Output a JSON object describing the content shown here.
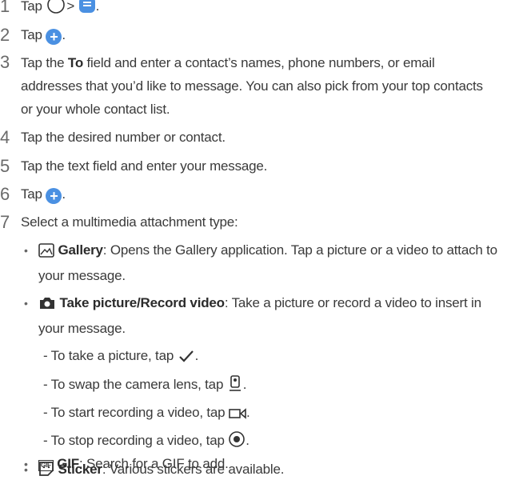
{
  "steps": [
    {
      "n": "1",
      "pre": "Tap",
      "mid": ">",
      "post": "."
    },
    {
      "n": "2",
      "pre": "Tap",
      "post": "."
    },
    {
      "n": "3",
      "a": "Tap the ",
      "b": "To",
      "c": " field and enter a contact’s names, phone numbers, or email addresses that you’d like to message. You can also pick from your top contacts or your whole contact list."
    },
    {
      "n": "4",
      "text": "Tap the desired number or contact."
    },
    {
      "n": "5",
      "text": "Tap the text field and enter your message."
    },
    {
      "n": "6",
      "pre": "Tap",
      "post": "."
    },
    {
      "n": "7",
      "text": "Select a multimedia attachment type:"
    }
  ],
  "bullets": {
    "dot": "•",
    "gallery": {
      "title": "Gallery",
      "text": ": Opens the Gallery application. Tap a picture or a video to attach to your message."
    },
    "take": {
      "title": "Take picture/Record video",
      "text": ": Take a picture or record a video to insert in your message."
    },
    "subs": [
      {
        "text": "- To take a picture, tap",
        "end": "."
      },
      {
        "text": "- To swap the camera lens, tap",
        "end": "."
      },
      {
        "text": "- To start recording a video, tap",
        "end": "."
      },
      {
        "text": "- To stop recording a video, tap",
        "end": "."
      }
    ],
    "gif": {
      "title": "GIF",
      "text": ": Search for a GIF to add.",
      "icon_label": "GIF"
    },
    "sticker": {
      "title": "Sticker",
      "text": ": Various stickers are available."
    }
  },
  "icons": {
    "home": "circle-icon",
    "messages": "message-app-icon",
    "compose": "plus-icon",
    "attach": "plus-icon",
    "gallery": "gallery-icon",
    "camera": "camera-icon",
    "check": "check-icon",
    "swap": "swap-camera-icon",
    "video": "video-icon",
    "stop": "stop-record-icon",
    "gif": "gif-icon",
    "sticker": "sticker-icon"
  },
  "colors": {
    "accent": "#4a90e2",
    "text": "#3a3a3a"
  }
}
